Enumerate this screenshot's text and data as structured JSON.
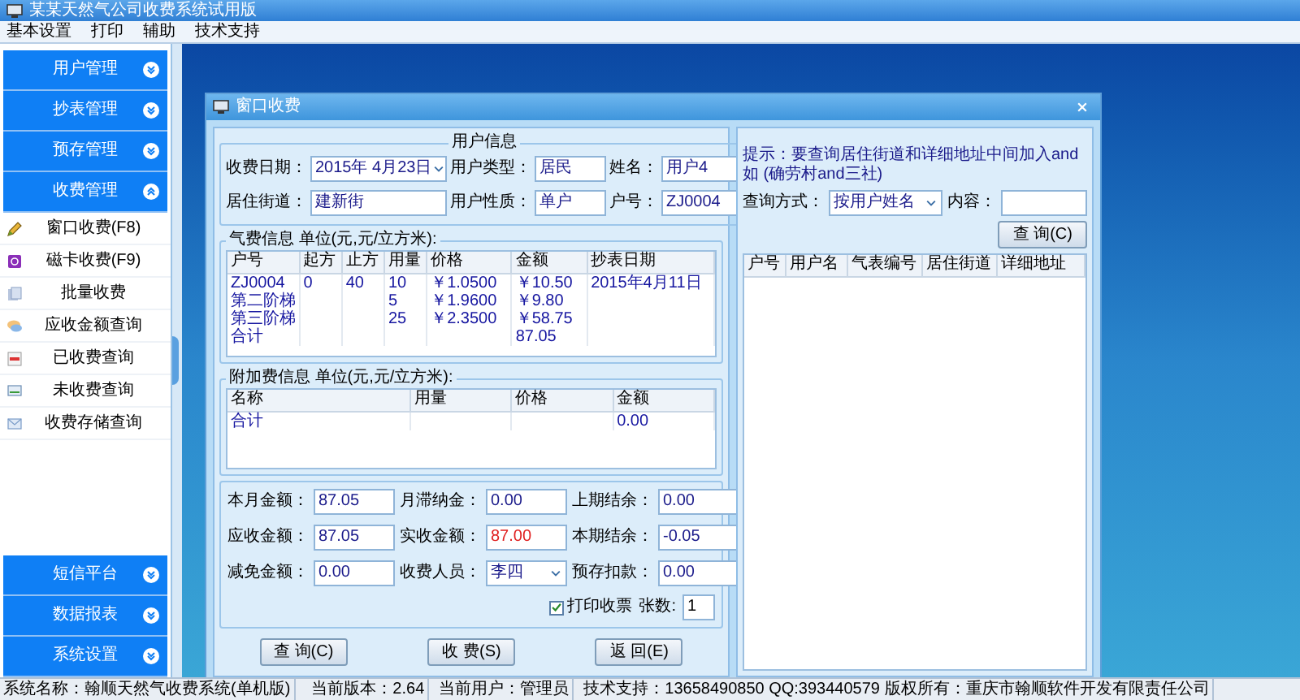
{
  "window": {
    "title": "某某天然气公司收费系统试用版"
  },
  "menu": [
    "基本设置",
    "打印",
    "辅助",
    "技术支持"
  ],
  "sidebar": {
    "groups": [
      {
        "label": "用户管理",
        "expanded": false
      },
      {
        "label": "抄表管理",
        "expanded": false
      },
      {
        "label": "预存管理",
        "expanded": false
      },
      {
        "label": "收费管理",
        "expanded": true,
        "items": [
          {
            "label": "窗口收费(F8)",
            "kind": "pencil"
          },
          {
            "label": "磁卡收费(F9)",
            "kind": "card"
          },
          {
            "label": "批量收费",
            "kind": "stack"
          },
          {
            "label": "应收金额查询",
            "kind": "chat"
          },
          {
            "label": "已收费查询",
            "kind": "receipt"
          },
          {
            "label": "未收费查询",
            "kind": "monitor"
          },
          {
            "label": "收费存储查询",
            "kind": "mail"
          }
        ]
      },
      {
        "label": "短信平台",
        "expanded": false
      },
      {
        "label": "数据报表",
        "expanded": false
      },
      {
        "label": "系统设置",
        "expanded": false
      }
    ]
  },
  "dialog": {
    "title": "窗口收费",
    "user_info": {
      "legend": "用户信息",
      "fields": [
        {
          "label": "收费日期：",
          "value": "2015年 4月23日",
          "kind": "date"
        },
        {
          "label": "用户类型：",
          "value": "居民",
          "kind": "text"
        },
        {
          "label": "姓名：",
          "value": "用户4",
          "kind": "text"
        },
        {
          "label": "居住街道：",
          "value": "建新街",
          "kind": "text"
        },
        {
          "label": "用户性质：",
          "value": "单户",
          "kind": "text"
        },
        {
          "label": "户号：",
          "value": "ZJ0004",
          "kind": "text"
        }
      ]
    },
    "gas_table": {
      "legend": "气费信息 单位(元,元/立方米):",
      "columns": [
        "户号",
        "起方",
        "止方",
        "用量",
        "价格",
        "金额",
        "抄表日期"
      ],
      "rows": [
        [
          "ZJ0004",
          "0",
          "40",
          "10",
          "￥1.0500",
          "￥10.50",
          "2015年4月11日"
        ],
        [
          "第二阶梯",
          "",
          "",
          "5",
          "￥1.9600",
          "￥9.80",
          ""
        ],
        [
          "第三阶梯",
          "",
          "",
          "25",
          "￥2.3500",
          "￥58.75",
          ""
        ],
        [
          "合计",
          "",
          "",
          "",
          "",
          "87.05",
          ""
        ]
      ]
    },
    "extra_table": {
      "legend": "附加费信息 单位(元,元/立方米):",
      "columns": [
        "名称",
        "用量",
        "价格",
        "金额"
      ],
      "rows": [
        [
          "合计",
          "",
          "",
          "0.00"
        ]
      ]
    },
    "amounts": [
      {
        "label": "本月金额：",
        "value": "87.05",
        "kind": "text",
        "highlight": false
      },
      {
        "label": "月滞纳金：",
        "value": "0.00",
        "kind": "text",
        "highlight": false
      },
      {
        "label": "上期结余：",
        "value": "0.00",
        "kind": "text",
        "highlight": false
      },
      {
        "label": "应收金额：",
        "value": "87.05",
        "kind": "text",
        "highlight": false
      },
      {
        "label": "实收金额：",
        "value": "87.00",
        "kind": "text",
        "highlight": true
      },
      {
        "label": "本期结余：",
        "value": "-0.05",
        "kind": "text",
        "highlight": false
      },
      {
        "label": "减免金额：",
        "value": "0.00",
        "kind": "text",
        "highlight": false
      },
      {
        "label": "收费人员：",
        "value": "李四",
        "kind": "select",
        "highlight": false
      },
      {
        "label": "预存扣款：",
        "value": "0.00",
        "kind": "text",
        "highlight": false
      }
    ],
    "print_receipt": {
      "label": "打印收票",
      "checked": true
    },
    "copies": {
      "label": "张数:",
      "value": "1"
    },
    "buttons": [
      "查 询(C)",
      "收 费(S)",
      "返 回(E)"
    ],
    "search": {
      "hint": "提示：要查询居住街道和详细地址中间加入and 如 (确劳村and三社)",
      "mode_label": "查询方式：",
      "mode_value": "按用户姓名",
      "content_label": "内容：",
      "button": "查 询(C)",
      "columns": [
        "户号",
        "用户名",
        "气表编号",
        "居住街道",
        "详细地址"
      ]
    }
  },
  "status_bar": [
    "系统名称：翰顺天然气收费系统(单机版)",
    "当前版本：2.64",
    "当前用户：管理员",
    "技术支持：13658490850 QQ:393440579 版权所有：重庆市翰顺软件开发有限责任公司"
  ]
}
